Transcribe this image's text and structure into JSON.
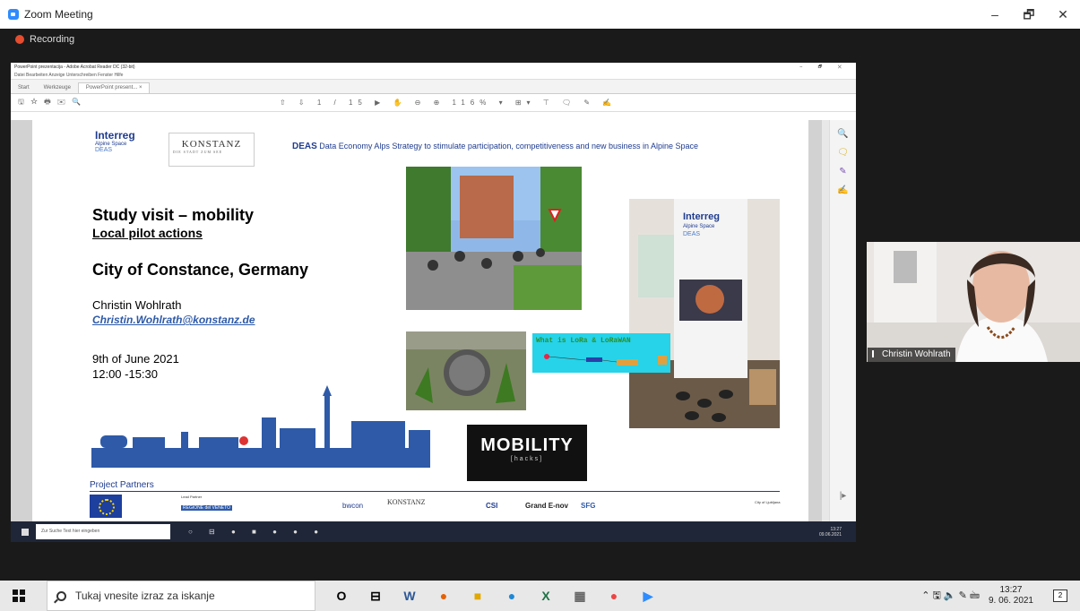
{
  "window": {
    "title": "Zoom Meeting",
    "minimize": "–",
    "restore": "🗗",
    "close": "✕"
  },
  "recording": {
    "label": "Recording"
  },
  "acrobat": {
    "title": "PowerPoint prezentacija - Adobe Acrobat Reader DC (32-bit)",
    "title_controls": "– 🗗 ✕",
    "menu": "Datei  Bearbeiten  Anzeige  Unterschreiben  Fenster  Hilfe",
    "tabs": [
      "Start",
      "Werkzeuge",
      "PowerPoint present... ×"
    ],
    "tool_left": "🖫☆🖶✉🔍",
    "tool_mid": "⇧ ⇩  1 / 15   ▶ ✋ ⊖ ⊕  116% ▾  ⊞▾ ⊤   🗨 ✎ ✍",
    "sidebar_icons": [
      "🔍",
      "🗨",
      "✎",
      "✍"
    ],
    "sidebar_bottom": "|▸"
  },
  "slide": {
    "interreg": "Interreg",
    "alpine_space": "Alpine Space",
    "deas_small": "DEAS",
    "konstanz": "KONSTANZ",
    "konstanz_sub": "DIE STADT ZUM SEE",
    "deas_bold": "DEAS",
    "deas_text": " Data Economy Alps Strategy to stimulate participation, competitiveness and new business in Alpine Space",
    "title": "Study visit – mobility",
    "subtitle": "Local pilot actions",
    "city": "City of Constance, Germany",
    "name": "Christin Wohlrath",
    "email": "Christin.Wohlrath@konstanz.de",
    "date": "9th of June 2021",
    "time": "12:00 -15:30",
    "lora": "What is LoRa & LoRaWAN",
    "banner_interreg": "Interreg",
    "banner_alpine": "Alpine Space",
    "banner_deas": "DEAS",
    "mobility_main": "MOBILITY",
    "mobility_sub": "[hacks]",
    "partners_title": "Project Partners",
    "lead_partner": "Lead Partner",
    "partner_logos": [
      "REGIONE del VENETO",
      "bwcon",
      "KONSTANZ",
      "CSI",
      "Grand E-nov",
      "SFG",
      "City of Ljubljana"
    ]
  },
  "inner_taskbar": {
    "search_placeholder": "Zur Suche Text hier eingeben",
    "apps": "○ ⊟ ● ■ ● ● ●",
    "time": "13:27",
    "date": "09.06.2021"
  },
  "video": {
    "participant": "Christin Wohlrath"
  },
  "taskbar": {
    "search_placeholder": "Tukaj vnesite izraz za iskanje",
    "icons": [
      "O",
      "⊟",
      "W",
      "●",
      "■",
      "●",
      "X",
      "▦",
      "●",
      "▶"
    ],
    "tray": "⌃ 🖫 🔈 ✎ 🖮",
    "time": "13:27",
    "date": "9. 06. 2021",
    "notifications": "2"
  }
}
